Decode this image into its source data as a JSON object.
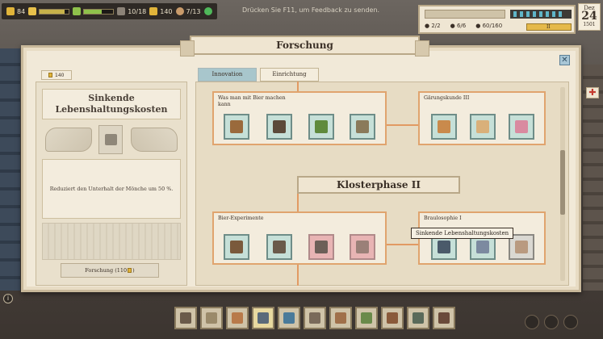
{
  "hud": {
    "gold_left": "84",
    "ratio_1": "10/18",
    "coins": "140",
    "ratio_2": "7/13",
    "feedback_hint": "Drücken Sie F11, um Feedback zu senden."
  },
  "status_panel": {
    "monks": "2/2",
    "beds": "6/6",
    "storage": "60/160",
    "level": "II"
  },
  "date": {
    "month": "Dez",
    "day": "24",
    "year": "1501"
  },
  "dialog": {
    "title": "Forschung",
    "close_label": "✕"
  },
  "left_panel": {
    "cost": "140",
    "title": "Sinkende Lebenshaltungskosten",
    "description": "Reduziert den Unterhalt der Mönche um 50 %.",
    "research_button": "Forschung (110",
    "research_button_suffix": ")"
  },
  "tabs": [
    {
      "label": "Innovation",
      "active": true
    },
    {
      "label": "Einrichtung",
      "active": false
    }
  ],
  "tree": {
    "nodes": [
      {
        "title": "Was man mit Bier machen kann"
      },
      {
        "title": "Gärungskunde III"
      },
      {
        "title": "Bier-Experimente"
      },
      {
        "title": "Braulosophie I"
      }
    ],
    "phase_banner": "Klosterphase II",
    "tooltip": "Sinkende Lebenshaltungskosten"
  },
  "colors": {
    "accent_orange": "#e29a63",
    "tab_active": "#a8c6cc",
    "slot_unlocked": "#c6e0d8",
    "slot_locked": "#e8b4b4",
    "gold": "#e1b43a"
  },
  "icons": [
    "beer-icon",
    "hammer-icon",
    "plant-icon",
    "barrel-icon",
    "bread-icon",
    "scroll-icon",
    "tea-pot-icon",
    "gears-icon",
    "cart-icon",
    "anvil-icon",
    "mug-icon",
    "bottle-icon",
    "lantern-icon",
    "hand-icon"
  ]
}
